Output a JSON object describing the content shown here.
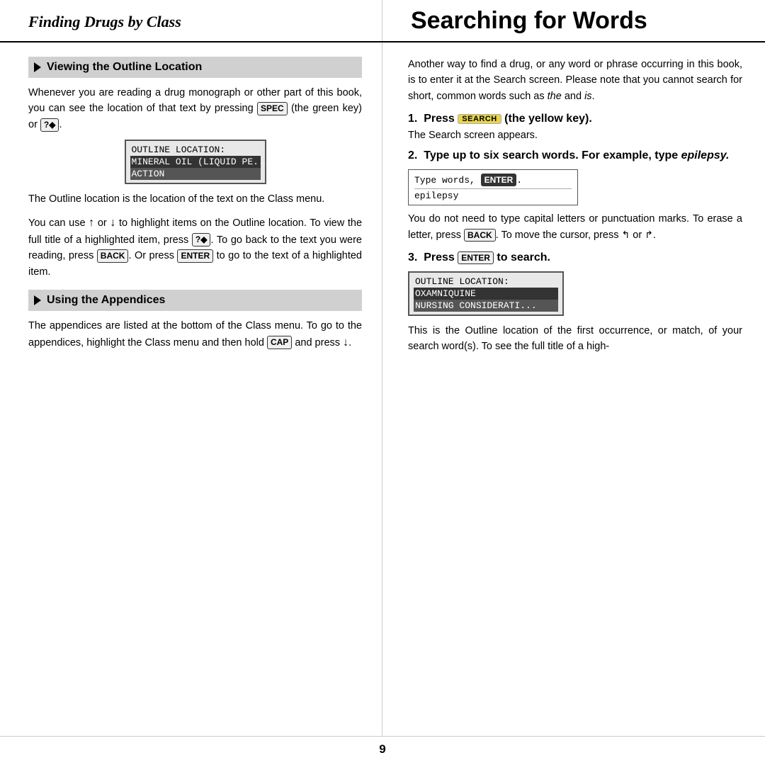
{
  "header": {
    "left_title": "Finding Drugs by Class",
    "right_title": "Searching for Words"
  },
  "left_column": {
    "section1": {
      "label": "Viewing the Outline Location",
      "body1": "Whenever you are reading a drug monograph or other part of this book, you can see the location of that text by pressing",
      "key_spec": "SPEC",
      "body1b": "(the green key) or",
      "key_q": "?",
      "lcd": {
        "row1": "OUTLINE LOCATION:",
        "row2": "MINERAL OIL (LIQUID PE...",
        "row3": "ACTION"
      },
      "body2": "The Outline location is the location of the text on the Class menu.",
      "body3_pre": "You can use",
      "body3_post": "or",
      "body3_end": "to highlight items on the Outline location. To view the full title of a highlighted item, press",
      "key_q2": "?",
      "body3_end2": ". To go back to the text you were reading, press",
      "key_back": "BACK",
      "body3_end3": ". Or press",
      "key_enter": "ENTER",
      "body3_end4": "to go to the text of a highlighted item."
    },
    "section2": {
      "label": "Using the Appendices",
      "body1": "The appendices are listed at the bottom of the Class menu. To go to the appendices, highlight the Class menu and then hold",
      "key_cap": "CAP",
      "body2": "and press",
      "arrow_down": "↓"
    }
  },
  "right_column": {
    "intro": "Another way to find a drug, or any word or phrase occurring in this book, is to enter it at the Search screen. Please note that you cannot search for short, common words such as the and is.",
    "step1": {
      "number": "1.",
      "text_pre": "Press",
      "key": "SEARCH",
      "text_post": "(the yellow key).",
      "sub": "The Search screen appears."
    },
    "step2": {
      "number": "2.",
      "text": "Type up to six search words. For example, type",
      "italic_word": "epilepsy.",
      "search_box": {
        "row1": "Type words, ENTER.",
        "row2": "epilepsy"
      }
    },
    "step2_body": "You do not need to type capital letters or punctuation marks. To erase a letter, press",
    "key_back": "BACK",
    "step2_body2": ". To move the cursor, press",
    "arrow_left_sym": "←",
    "or_text": "or",
    "arrow_right_sym": "→",
    "step3": {
      "number": "3.",
      "text_pre": "Press",
      "key": "ENTER",
      "text_post": "to search."
    },
    "lcd2": {
      "row1": "OUTLINE LOCATION:",
      "row2": "OXAMNIQUINE",
      "row3": "NURSING CONSIDERATI..."
    },
    "body_end": "This is the Outline location of the first occurrence, or match, of your search word(s). To see the full title of a high-"
  },
  "footer": {
    "page_number": "9"
  }
}
